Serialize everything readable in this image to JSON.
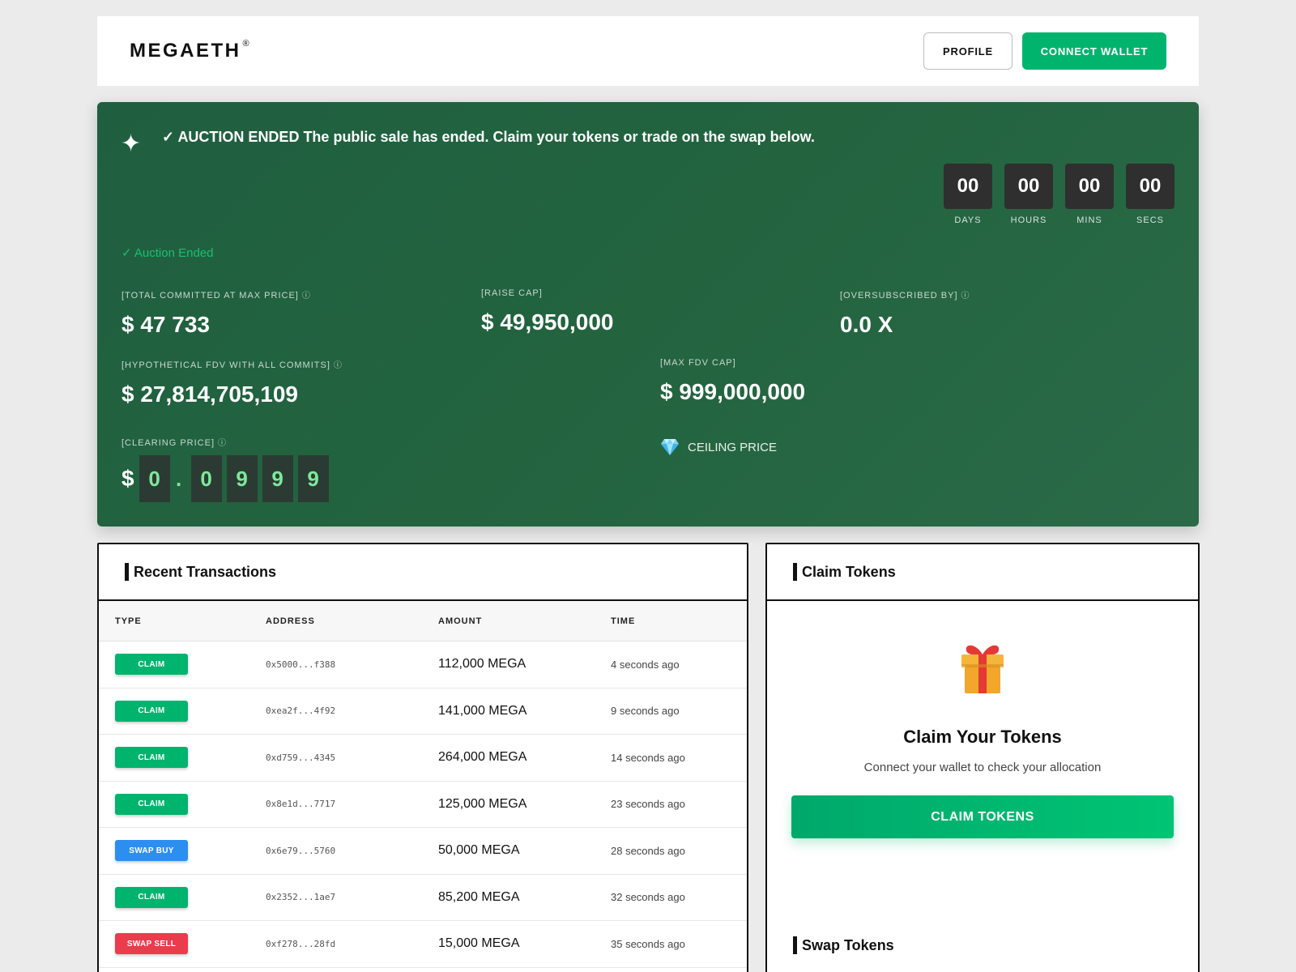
{
  "header": {
    "logo": "MEGAETH",
    "logo_mark": "®",
    "profile_label": "PROFILE",
    "connect_label": "CONNECT WALLET"
  },
  "hero": {
    "banner_check": "✓",
    "banner_text": "AUCTION ENDED The public sale has ended. Claim your tokens or trade on the swap below.",
    "countdown": [
      {
        "value": "00",
        "label": "DAYS"
      },
      {
        "value": "00",
        "label": "HOURS"
      },
      {
        "value": "00",
        "label": "MINS"
      },
      {
        "value": "00",
        "label": "SECS"
      }
    ],
    "status": "✓ Auction Ended",
    "stats": {
      "total_committed": {
        "label": "[TOTAL COMMITTED AT MAX PRICE]",
        "value": "$ 47 733"
      },
      "raise_cap": {
        "label": "[RAISE CAP]",
        "value": "$ 49,950,000"
      },
      "oversubscribed": {
        "label": "[OVERSUBSCRIBED BY]",
        "value": "0.0 X"
      },
      "hypothetical_fdv": {
        "label": "[HYPOTHETICAL FDV WITH ALL COMMITS]",
        "value": "$ 27,814,705,109"
      },
      "max_fdv_cap": {
        "label": "[MAX FDV CAP]",
        "value": "$ 999,000,000"
      }
    },
    "clearing_price": {
      "label": "[CLEARING PRICE]",
      "currency": "$",
      "digits": [
        "0",
        ".",
        "0",
        "9",
        "9",
        "9"
      ]
    },
    "ceiling_label": "CEILING PRICE",
    "info_icon": "ⓘ"
  },
  "transactions": {
    "title": "Recent Transactions",
    "columns": [
      "TYPE",
      "ADDRESS",
      "AMOUNT",
      "TIME"
    ],
    "rows": [
      {
        "type": "CLAIM",
        "kind": "claim",
        "address": "0x5000...f388",
        "amount": "112,000 MEGA",
        "time": "4 seconds ago"
      },
      {
        "type": "CLAIM",
        "kind": "claim",
        "address": "0xea2f...4f92",
        "amount": "141,000 MEGA",
        "time": "9 seconds ago"
      },
      {
        "type": "CLAIM",
        "kind": "claim",
        "address": "0xd759...4345",
        "amount": "264,000 MEGA",
        "time": "14 seconds ago"
      },
      {
        "type": "CLAIM",
        "kind": "claim",
        "address": "0x8e1d...7717",
        "amount": "125,000 MEGA",
        "time": "23 seconds ago"
      },
      {
        "type": "SWAP BUY",
        "kind": "buy",
        "address": "0x6e79...5760",
        "amount": "50,000 MEGA",
        "time": "28 seconds ago"
      },
      {
        "type": "CLAIM",
        "kind": "claim",
        "address": "0x2352...1ae7",
        "amount": "85,200 MEGA",
        "time": "32 seconds ago"
      },
      {
        "type": "SWAP SELL",
        "kind": "sell",
        "address": "0xf278...28fd",
        "amount": "15,000 MEGA",
        "time": "35 seconds ago"
      }
    ]
  },
  "claim": {
    "title": "Claim Tokens",
    "heading": "Claim Your Tokens",
    "subtitle": "Connect your wallet to check your allocation",
    "button_label": "CLAIM TOKENS",
    "swap_title": "Swap Tokens"
  }
}
